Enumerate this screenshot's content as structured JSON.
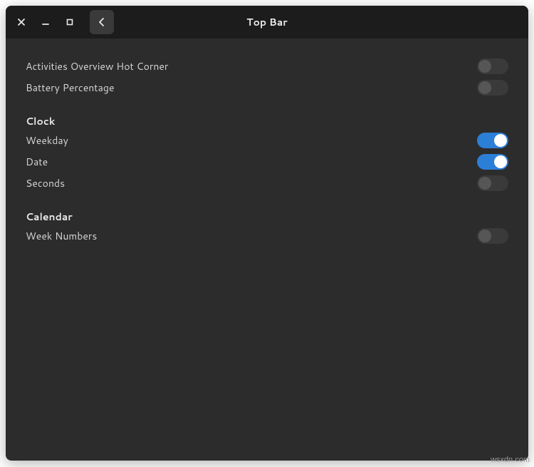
{
  "window": {
    "title": "Top Bar"
  },
  "rows": {
    "activities": {
      "label": "Activities Overview Hot Corner",
      "on": false
    },
    "battery": {
      "label": "Battery Percentage",
      "on": false
    },
    "weekday": {
      "label": "Weekday",
      "on": true
    },
    "date": {
      "label": "Date",
      "on": true
    },
    "seconds": {
      "label": "Seconds",
      "on": false
    },
    "weeknum": {
      "label": "Week Numbers",
      "on": false
    }
  },
  "sections": {
    "clock": "Clock",
    "calendar": "Calendar"
  },
  "watermark": "wsxdn.com"
}
